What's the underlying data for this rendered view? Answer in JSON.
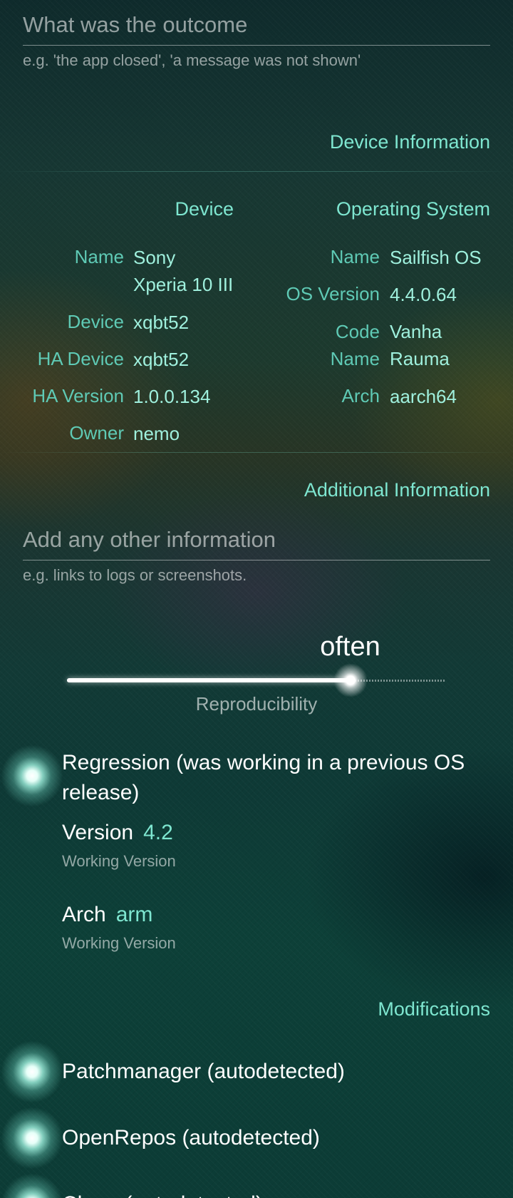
{
  "outcome": {
    "placeholder": "What was the outcome",
    "hint": "e.g. 'the app closed', 'a message was not shown'"
  },
  "device_info": {
    "section_header": "Device Information",
    "device": {
      "title": "Device",
      "rows": [
        {
          "label": "Name",
          "value": "Sony\nXperia 10 III"
        },
        {
          "label": "Device",
          "value": "xqbt52"
        },
        {
          "label": "HA Device",
          "value": "xqbt52"
        },
        {
          "label": "HA Version",
          "value": "1.0.0.134"
        },
        {
          "label": "Owner",
          "value": "nemo"
        }
      ]
    },
    "os": {
      "title": "Operating System",
      "rows": [
        {
          "label": "Name",
          "value": "Sailfish OS"
        },
        {
          "label": "OS Version",
          "value": "4.4.0.64"
        },
        {
          "label": "Code\nName",
          "value": "Vanha\nRauma"
        },
        {
          "label": "Arch",
          "value": "aarch64"
        }
      ]
    }
  },
  "additional": {
    "section_header": "Additional Information",
    "placeholder": "Add any other information",
    "hint": "e.g. links to logs or screenshots."
  },
  "reproducibility": {
    "value_text": "often",
    "label": "Reproducibility",
    "level_fraction": 0.75
  },
  "regression": {
    "label": "Regression (was working in a previous OS release)",
    "checked": true,
    "version": {
      "label": "Version",
      "value": "4.2",
      "description": "Working Version"
    },
    "arch": {
      "label": "Arch",
      "value": "arm",
      "description": "Working Version"
    }
  },
  "modifications": {
    "section_header": "Modifications",
    "items": [
      {
        "label": "Patchmanager (autodetected)",
        "checked": true
      },
      {
        "label": "OpenRepos (autodetected)",
        "checked": true
      },
      {
        "label": "Chum (autodetected)",
        "checked": true
      }
    ]
  },
  "colors": {
    "accent": "#7ee6d0",
    "secondary_accent": "#5fcab5",
    "hint": "#9fb3ae",
    "background": "#123a36"
  }
}
